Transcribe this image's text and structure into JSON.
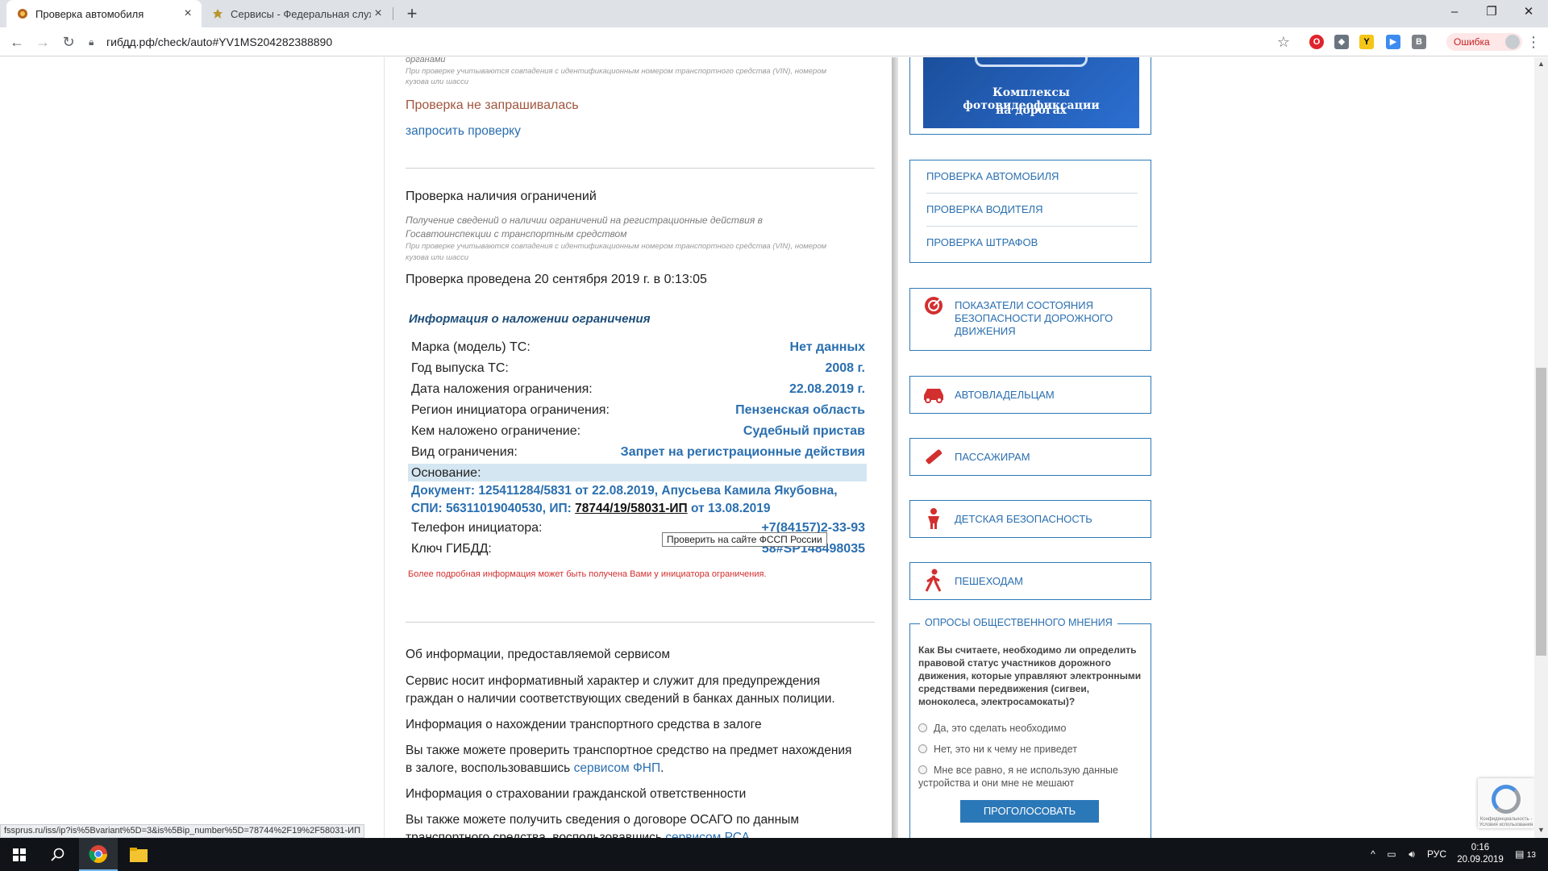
{
  "browser": {
    "tabs": [
      {
        "title": "Проверка автомобиля",
        "active": true
      },
      {
        "title": "Сервисы - Федеральная служба",
        "active": false
      }
    ],
    "url": "гибдд.рф/check/auto#YV1MS204282388890",
    "error_label": "Ошибка",
    "window_controls": [
      "–",
      "❐",
      "✕"
    ]
  },
  "main": {
    "top_note_word": "органами",
    "top_note_vin": "При проверке учитываются совпадения с идентификационным номером транспортного средства (VIN), номером",
    "top_note_vin2": "кузова или шасси",
    "wanted_status": "Проверка не запрашивалась",
    "request_link": "запросить проверку",
    "restrictions": {
      "heading": "Проверка наличия ограничений",
      "desc_line1": "Получение сведений о наличии ограничений на регистрационные действия в",
      "desc_line2": "Госавтоинспекции с транспортным средством",
      "vin_note1": "При проверке учитываются совпадения с идентификационным номером транспортного средства (VIN), номером",
      "vin_note2": "кузова или шасси",
      "performed": "Проверка проведена 20 сентября 2019 г. в 0:13:05",
      "info_title": "Информация о наложении ограничения",
      "rows": [
        {
          "label": "Марка (модель) ТС:",
          "value": "Нет данных"
        },
        {
          "label": "Год выпуска ТС:",
          "value": "2008 г."
        },
        {
          "label": "Дата наложения ограничения:",
          "value": "22.08.2019 г."
        },
        {
          "label": "Регион инициатора ограничения:",
          "value": "Пензенская область"
        },
        {
          "label": "Кем наложено ограничение:",
          "value": "Судебный пристав"
        },
        {
          "label": "Вид ограничения:",
          "value": "Запрет на регистрационные действия"
        }
      ],
      "basis_label": "Основание:",
      "basis_line1": "Документ: 125411284/5831 от 22.08.2019, Апусьева Камила Якубовна,",
      "basis_line2_prefix": "СПИ: 56311019040530, ИП:",
      "basis_ip_link": "78744/19/58031-ИП",
      "basis_line2_suffix": "от 13.08.2019",
      "phone_label": "Телефон инициатора:",
      "phone_value": "+7(84157)2-33-93",
      "key_label": "Ключ ГИБДД:",
      "key_value": "58#SP148498035",
      "tooltip": "Проверить на сайте ФССП России",
      "more_info": "Более подробная информация может быть получена Вами у инициатора ограничения."
    },
    "about": {
      "heading": "Об информации, предоставляемой сервисом",
      "p1_line1": "Сервис носит информативный характер и служит для предупреждения",
      "p1_line2": "граждан о наличии соответствующих сведений в банках данных полиции.",
      "pledge_heading": "Информация о нахождении транспортного средства в залоге",
      "pledge_line1": "Вы также можете проверить транспортное средство на предмет нахождения",
      "pledge_line2_prefix": "в залоге, воспользовавшись",
      "pledge_link": "сервисом ФНП",
      "pledge_line2_suffix": ".",
      "insurance_heading": "Информация о страховании гражданской ответственности",
      "insurance_line1": "Вы также можете получить сведения о договоре ОСАГО по данным",
      "insurance_line2_prefix": "транспортного средства, воспользовавшись",
      "insurance_link": "сервисом РСА"
    }
  },
  "sidebar": {
    "banner_line1": "Комплексы фотовидеофиксации",
    "banner_line2": "на дорогах",
    "check_menu": [
      "ПРОВЕРКА АВТОМОБИЛЯ",
      "ПРОВЕРКА ВОДИТЕЛЯ",
      "ПРОВЕРКА ШТРАФОВ"
    ],
    "safety_line1": "ПОКАЗАТЕЛИ СОСТОЯНИЯ",
    "safety_line2": "БЕЗОПАСНОСТИ ДОРОЖНОГО",
    "safety_line3": "ДВИЖЕНИЯ",
    "cards": [
      "АВТОВЛАДЕЛЬЦАМ",
      "ПАССАЖИРАМ",
      "ДЕТСКАЯ БЕЗОПАСНОСТЬ",
      "ПЕШЕХОДАМ"
    ],
    "poll": {
      "title": "ОПРОСЫ ОБЩЕСТВЕННОГО МНЕНИЯ",
      "question": "Как Вы считаете, необходимо ли определить правовой статус участников дорожного движения, которые управляют электронными средствами передвижения (сигвеи, моноколеса, электросамокаты)?",
      "options": [
        "Да, это сделать необходимо",
        "Нет, это ни к чему не приведет",
        "Мне все равно, я не использую данные",
        "устройства и они мне не мешают"
      ],
      "vote_label": "ПРОГОЛОСОВАТЬ"
    }
  },
  "status_url": "fssprus.ru/iss/ip?is%5Bvariant%5D=3&is%5Bip_number%5D=78744%2F19%2F58031-ИП",
  "recaptcha_caption": "Конфиденциальность - Условия использования",
  "taskbar": {
    "lang": "РУС",
    "time": "0:16",
    "date": "20.09.2019",
    "notifications": "13"
  }
}
